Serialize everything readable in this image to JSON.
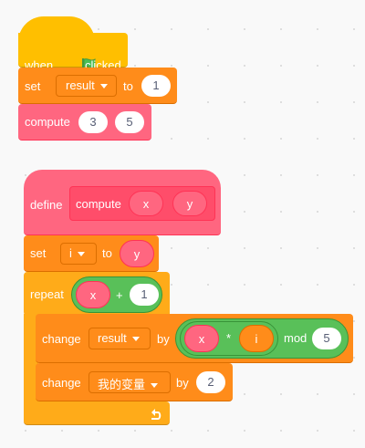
{
  "script1": {
    "hat": {
      "when": "when",
      "clicked": "clicked",
      "icon": "green-flag-icon"
    },
    "set_block": {
      "label": "set",
      "variable": "result",
      "to": "to",
      "value": "1"
    },
    "compute_call": {
      "label": "compute",
      "arg1": "3",
      "arg2": "5"
    }
  },
  "script2": {
    "define": {
      "label": "define",
      "proc_name": "compute",
      "param1": "x",
      "param2": "y"
    },
    "set_block": {
      "label": "set",
      "variable": "i",
      "to": "to",
      "value": "y"
    },
    "repeat": {
      "label": "repeat",
      "param": "x",
      "op": "+",
      "value": "1"
    },
    "change1": {
      "label": "change",
      "variable": "result",
      "by": "by",
      "param1": "x",
      "op": "*",
      "param2": "i",
      "mod": "mod",
      "value": "5"
    },
    "change2": {
      "label": "change",
      "variable": "我的变量",
      "by": "by",
      "value": "2"
    },
    "loop_icon": "loop-arrow-icon"
  },
  "colors": {
    "events": "#ffbf00",
    "variables": "#ff8c1a",
    "my_blocks": "#ff6680",
    "control": "#ffab19",
    "operators": "#59c059"
  }
}
